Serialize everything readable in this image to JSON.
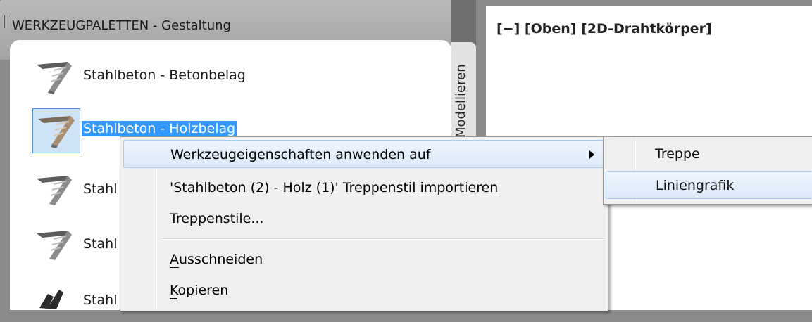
{
  "palette": {
    "title": "WERKZEUGPALETTEN - Gestaltung",
    "side_tab": "Modellieren",
    "tools": [
      {
        "label": "Stahlbeton - Betonbelag",
        "icon": "stair-concrete-icon"
      },
      {
        "label": "Stahlbeton - Holzbelag",
        "icon": "stair-wood-icon",
        "selected": true
      },
      {
        "label": "Stahl",
        "icon": "stair-concrete-icon"
      },
      {
        "label": "Stahl",
        "icon": "stair-concrete-icon"
      },
      {
        "label": "Stahl",
        "icon": "stair-dark-icon"
      }
    ]
  },
  "viewport": {
    "label": "[−] [Oben] [2D-Drahtkörper]"
  },
  "context_menu": {
    "items": [
      {
        "label": "Werkzeugeigenschaften anwenden auf",
        "submenu": true,
        "highlighted": true
      },
      {
        "label": "'Stahlbeton (2) - Holz (1)' Treppenstil importieren"
      },
      {
        "label": "Treppenstile..."
      },
      {
        "label": "Ausschneiden",
        "mnemonic": "A"
      },
      {
        "label": "Kopieren",
        "mnemonic": "K"
      }
    ]
  },
  "submenu": {
    "items": [
      {
        "label": "Treppe"
      },
      {
        "label": "Liniengrafik",
        "highlighted": true
      }
    ]
  },
  "colors": {
    "selection": "#3399ff",
    "menu_background": "#f0f0f0",
    "menu_highlight": "#dce9f9",
    "palette_header": "#a8a8a8"
  }
}
